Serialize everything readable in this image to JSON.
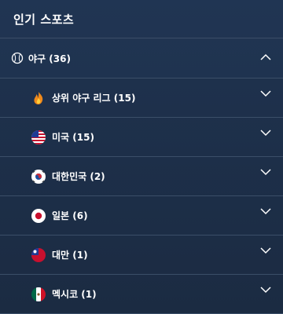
{
  "header": {
    "title": "인기 스포츠"
  },
  "sport": {
    "icon": "baseball-icon",
    "label": "야구 (36)"
  },
  "leagues": [
    {
      "label": "상위 야구 리그 (15)",
      "icon": "fire-icon"
    },
    {
      "label": "미국 (15)",
      "icon": "usa-flag-icon"
    },
    {
      "label": "대한민국 (2)",
      "icon": "south-korea-flag-icon"
    },
    {
      "label": "일본 (6)",
      "icon": "japan-flag-icon"
    },
    {
      "label": "대만 (1)",
      "icon": "taiwan-flag-icon"
    },
    {
      "label": "멕시코 (1)",
      "icon": "mexico-flag-icon"
    }
  ],
  "colors": {
    "background": "#1e3049",
    "divider": "#3b4e68",
    "text": "#ffffff"
  }
}
